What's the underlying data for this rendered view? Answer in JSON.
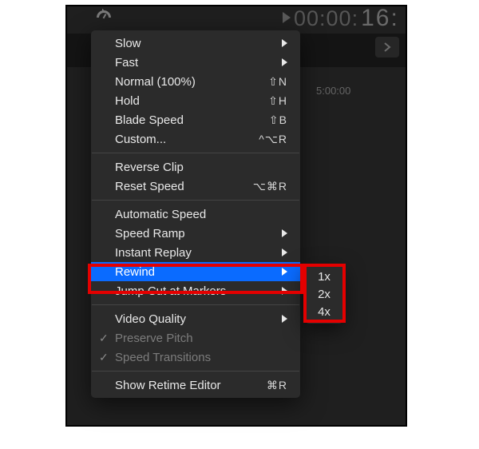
{
  "timecode_small": "00:00:",
  "timecode_big": "16:",
  "duration_label": "5:00:00",
  "menu": {
    "slow": "Slow",
    "fast": "Fast",
    "normal": "Normal (100%)",
    "normal_short": "⇧N",
    "hold": "Hold",
    "hold_short": "⇧H",
    "blade": "Blade Speed",
    "blade_short": "⇧B",
    "custom": "Custom...",
    "custom_short": "^⌥R",
    "reverse": "Reverse Clip",
    "reset": "Reset Speed",
    "reset_short": "⌥⌘R",
    "auto": "Automatic Speed",
    "ramp": "Speed Ramp",
    "replay": "Instant Replay",
    "rewind": "Rewind",
    "jump": "Jump Cut at Markers",
    "vq": "Video Quality",
    "preserve": "Preserve Pitch",
    "transitions": "Speed Transitions",
    "show": "Show Retime Editor",
    "show_short": "⌘R"
  },
  "submenu": {
    "x1": "1x",
    "x2": "2x",
    "x4": "4x"
  }
}
